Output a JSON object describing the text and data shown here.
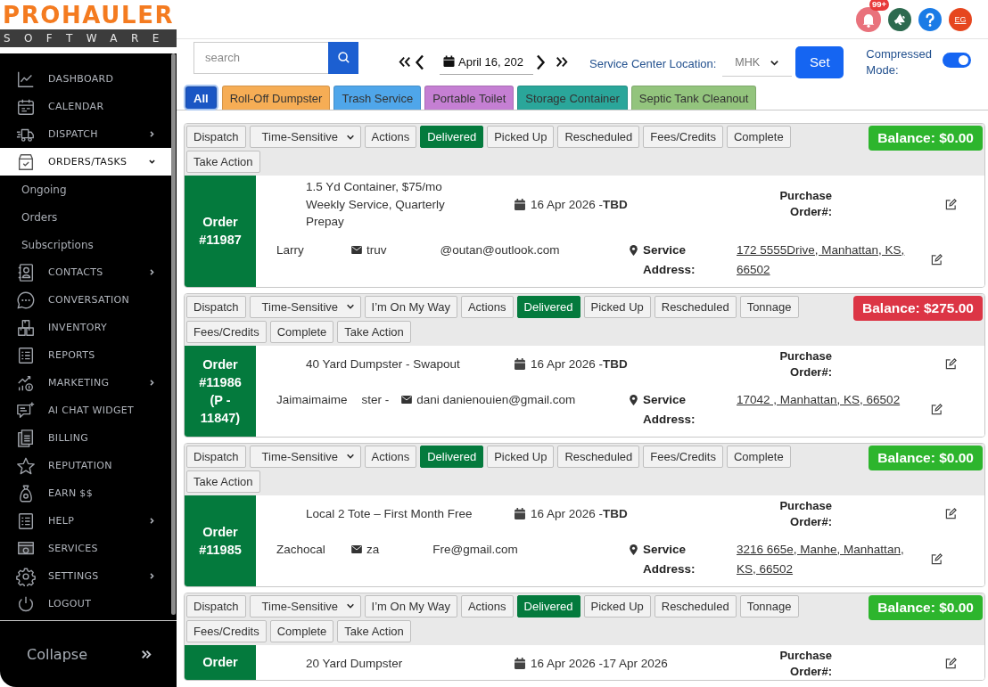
{
  "logo": {
    "name": "PROHAULER",
    "tagline": "SOFTWARE"
  },
  "sidebar": {
    "items": [
      {
        "label": "DASHBOARD",
        "selected": false
      },
      {
        "label": "CALENDAR",
        "selected": false
      },
      {
        "label": "DISPATCH",
        "selected": false,
        "expanded": false
      },
      {
        "label": "ORDERS/TASKS",
        "selected": true,
        "expanded": true,
        "children": [
          {
            "label": "Ongoing",
            "selected": false
          },
          {
            "label": "Orders",
            "selected": false
          },
          {
            "label": "Subscriptions",
            "selected": false
          }
        ]
      },
      {
        "label": "CONTACTS",
        "selected": false,
        "expanded": false
      },
      {
        "label": "CONVERSATION",
        "selected": false
      },
      {
        "label": "INVENTORY",
        "selected": false
      },
      {
        "label": "REPORTS",
        "selected": false
      },
      {
        "label": "MARKETING",
        "selected": false,
        "expanded": false
      },
      {
        "label": "AI CHAT WIDGET",
        "selected": false
      },
      {
        "label": "BILLING",
        "selected": false
      },
      {
        "label": "REPUTATION",
        "selected": false
      },
      {
        "label": "EARN $$",
        "selected": false
      },
      {
        "label": "HELP",
        "selected": false,
        "expanded": false
      },
      {
        "label": "SERVICES",
        "selected": false
      },
      {
        "label": "SETTINGS",
        "selected": false,
        "expanded": false
      },
      {
        "label": "LOGOUT",
        "selected": false
      }
    ],
    "collapse": "Collapse"
  },
  "header": {
    "notifications_badge": "99+",
    "user_initials": "EG"
  },
  "toolbar": {
    "search": {
      "placeholder": "search"
    },
    "date": "April 16, 202",
    "location_label": "Service Center Location:",
    "location": "MHK",
    "set_button": "Set",
    "compressed_mode": {
      "label": "Compressed Mode:",
      "on": true
    }
  },
  "filters": [
    {
      "label": "All",
      "color": "#1a56c4",
      "selected": true
    },
    {
      "label": "Roll-Off Dumpster",
      "color": "#f6ad55",
      "selected": false
    },
    {
      "label": "Trash Service",
      "color": "#4fa6ea",
      "selected": false
    },
    {
      "label": "Portable Toilet",
      "color": "#c57fd3",
      "selected": false
    },
    {
      "label": "Storage Container",
      "color": "#2aa69a",
      "selected": false
    },
    {
      "label": "Septic Tank Cleanout",
      "color": "#93c47d",
      "selected": false
    }
  ],
  "orders": [
    {
      "number": "Order #11987",
      "balance": {
        "text": "Balance: $0.00",
        "color": "#2db52d"
      },
      "actions": [
        {
          "label": "Dispatch",
          "kind": "button",
          "selected": false
        },
        {
          "label": "Time-Sensitive",
          "kind": "select",
          "selected": false
        },
        {
          "label": "Actions",
          "kind": "button",
          "selected": false
        },
        {
          "label": "Delivered",
          "kind": "button",
          "selected": true
        },
        {
          "label": "Picked Up",
          "kind": "button",
          "selected": false
        },
        {
          "label": "Rescheduled",
          "kind": "button",
          "selected": false
        },
        {
          "label": "Fees/Credits",
          "kind": "button",
          "selected": false
        },
        {
          "label": "Complete",
          "kind": "button",
          "selected": false
        },
        {
          "label": "Take Action",
          "kind": "button",
          "selected": false
        }
      ],
      "title": "1.5 Yd Container, $75/mo Weekly Service, Quarterly Prepay",
      "date": "16 Apr 2026 -**TBD**",
      "po_label": "Purchase Order#:",
      "customer": [
        "Larry"
      ],
      "email": [
        "truv",
        "@outan@outlook.com"
      ],
      "address_label": "Service Address:",
      "address": "172 5555Drive, Manhattan, KS, 66502"
    },
    {
      "number": "Order #11986 (P - 11847)",
      "balance": {
        "text": "Balance: $275.00",
        "color": "#dc3545"
      },
      "actions": [
        {
          "label": "Dispatch",
          "kind": "button",
          "selected": false
        },
        {
          "label": "Time-Sensitive",
          "kind": "select",
          "selected": false
        },
        {
          "label": "I’m On My Way",
          "kind": "button",
          "selected": false
        },
        {
          "label": "Actions",
          "kind": "button",
          "selected": false
        },
        {
          "label": "Delivered",
          "kind": "button",
          "selected": true
        },
        {
          "label": "Picked Up",
          "kind": "button",
          "selected": false
        },
        {
          "label": "Rescheduled",
          "kind": "button",
          "selected": false
        },
        {
          "label": "Tonnage",
          "kind": "button",
          "selected": false
        },
        {
          "label": "Fees/Credits",
          "kind": "button",
          "selected": false
        },
        {
          "label": "Complete",
          "kind": "button",
          "selected": false
        },
        {
          "label": "Take Action",
          "kind": "button",
          "selected": false
        }
      ],
      "title": "40 Yard Dumpster - Swapout",
      "date": "16 Apr 2026 -**TBD**",
      "po_label": "Purchase Order#:",
      "customer": [
        "Jaimaimaime",
        "ster -"
      ],
      "email": [
        "dani danienouien@gmail.com"
      ],
      "address_label": "Service Address:",
      "address": "17042 , Manhattan, KS, 66502"
    },
    {
      "number": "Order #11985",
      "balance": {
        "text": "Balance: $0.00",
        "color": "#2db52d"
      },
      "actions": [
        {
          "label": "Dispatch",
          "kind": "button",
          "selected": false
        },
        {
          "label": "Time-Sensitive",
          "kind": "select",
          "selected": false
        },
        {
          "label": "Actions",
          "kind": "button",
          "selected": false
        },
        {
          "label": "Delivered",
          "kind": "button",
          "selected": true
        },
        {
          "label": "Picked Up",
          "kind": "button",
          "selected": false
        },
        {
          "label": "Rescheduled",
          "kind": "button",
          "selected": false
        },
        {
          "label": "Fees/Credits",
          "kind": "button",
          "selected": false
        },
        {
          "label": "Complete",
          "kind": "button",
          "selected": false
        },
        {
          "label": "Take Action",
          "kind": "button",
          "selected": false
        }
      ],
      "title": "Local 2 Tote – First Month Free",
      "date": "16 Apr 2026 -**TBD**",
      "po_label": "Purchase Order#:",
      "customer": [
        "Zachocal"
      ],
      "email": [
        "za",
        "Fre@gmail.com"
      ],
      "address_label": "Service Address:",
      "address": "3216 665e, Manhe, Manhattan, KS, 66502"
    },
    {
      "number": "Order",
      "balance": {
        "text": "Balance: $0.00",
        "color": "#2db52d"
      },
      "actions": [
        {
          "label": "Dispatch",
          "kind": "button",
          "selected": false
        },
        {
          "label": "Time-Sensitive",
          "kind": "select",
          "selected": false
        },
        {
          "label": "I’m On My Way",
          "kind": "button",
          "selected": false
        },
        {
          "label": "Actions",
          "kind": "button",
          "selected": false
        },
        {
          "label": "Delivered",
          "kind": "button",
          "selected": true
        },
        {
          "label": "Picked Up",
          "kind": "button",
          "selected": false
        },
        {
          "label": "Rescheduled",
          "kind": "button",
          "selected": false
        },
        {
          "label": "Tonnage",
          "kind": "button",
          "selected": false
        },
        {
          "label": "Fees/Credits",
          "kind": "button",
          "selected": false
        },
        {
          "label": "Complete",
          "kind": "button",
          "selected": false
        },
        {
          "label": "Take Action",
          "kind": "button",
          "selected": false
        }
      ],
      "title": "20 Yard Dumpster",
      "date": "16 Apr 2026 -17 Apr 2026",
      "po_label": "Purchase Order#:"
    }
  ]
}
